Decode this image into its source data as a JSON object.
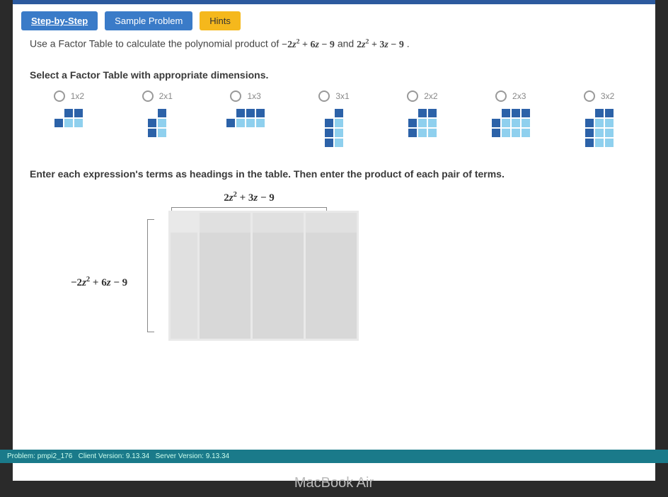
{
  "tabs": {
    "step": "Step-by-Step",
    "sample": "Sample Problem",
    "hints": "Hints"
  },
  "prompt_prefix": "Use a Factor Table to calculate the polynomial product of ",
  "poly1": "−2z² + 6z − 9",
  "prompt_mid": " and ",
  "poly2": "2z² + 3z − 9",
  "prompt_suffix": ".",
  "select_heading": "Select a Factor Table with appropriate dimensions.",
  "options": [
    {
      "label": "1x2"
    },
    {
      "label": "2x1"
    },
    {
      "label": "1x3"
    },
    {
      "label": "3x1"
    },
    {
      "label": "2x2"
    },
    {
      "label": "2x3"
    },
    {
      "label": "3x2"
    }
  ],
  "enter_heading": "Enter each expression's terms as headings in the table. Then enter the product of each pair of terms.",
  "top_poly": "2z² + 3z − 9",
  "left_poly": "−2z² + 6z − 9",
  "footer": {
    "problem": "Problem: pmpi2_176",
    "client": "Client Version: 9.13.34",
    "server": "Server Version: 9.13.34"
  },
  "device": "MacBook Air"
}
